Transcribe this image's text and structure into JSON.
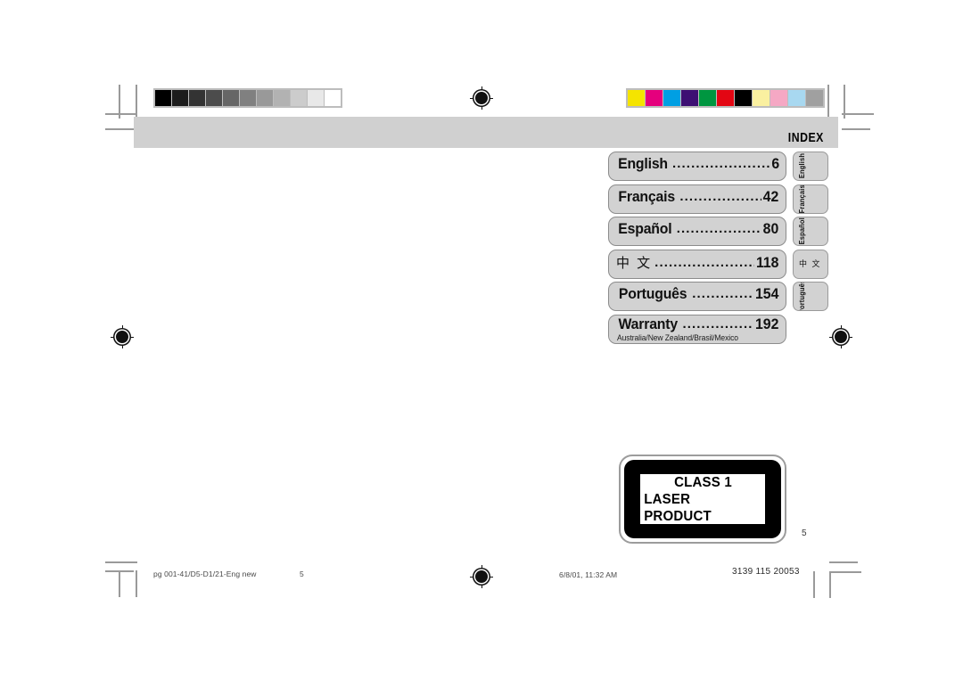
{
  "document": {
    "header_title": "INDEX",
    "page_number_label": "5"
  },
  "index": {
    "rows": [
      {
        "label": "English",
        "dots": "..............................",
        "page": "6",
        "tab": "English",
        "sub": ""
      },
      {
        "label": "Français",
        "dots": "..............................",
        "page": "42",
        "tab": "Français",
        "sub": ""
      },
      {
        "label": "Español",
        "dots": "..............................",
        "page": "80",
        "tab": "Español",
        "sub": ""
      },
      {
        "label": "中 文",
        "dots": "..................................",
        "page": "118",
        "tab": "中 文",
        "sub": ""
      },
      {
        "label": "Português",
        "dots": "..........................",
        "page": "154",
        "tab": "Português",
        "sub": ""
      },
      {
        "label": "Warranty",
        "dots": "...........................",
        "page": "192",
        "tab": "",
        "sub": "Australia/New Zealand/Brasil/Mexico"
      }
    ]
  },
  "laser_label": {
    "line1": "CLASS 1",
    "line2": "LASER PRODUCT"
  },
  "footer": {
    "file_name": "pg 001-41/D5-D1/21-Eng new",
    "page": "5",
    "date_time": "6/8/01, 11:32 AM",
    "doc_code": "3139 115 20053"
  },
  "calibration": {
    "grayscale_swatches": [
      "#000000",
      "#1c1c1c",
      "#333333",
      "#4c4c4c",
      "#666666",
      "#808080",
      "#999999",
      "#b2b2b2",
      "#cccccc",
      "#e8e8e8",
      "#ffffff"
    ],
    "color_swatches": [
      "#f5e400",
      "#e5007d",
      "#009fe3",
      "#3d0f73",
      "#009640",
      "#e30613",
      "#000000",
      "#faf0a0",
      "#f5a8c4",
      "#a8d8f0",
      "#a0a0a0"
    ]
  }
}
